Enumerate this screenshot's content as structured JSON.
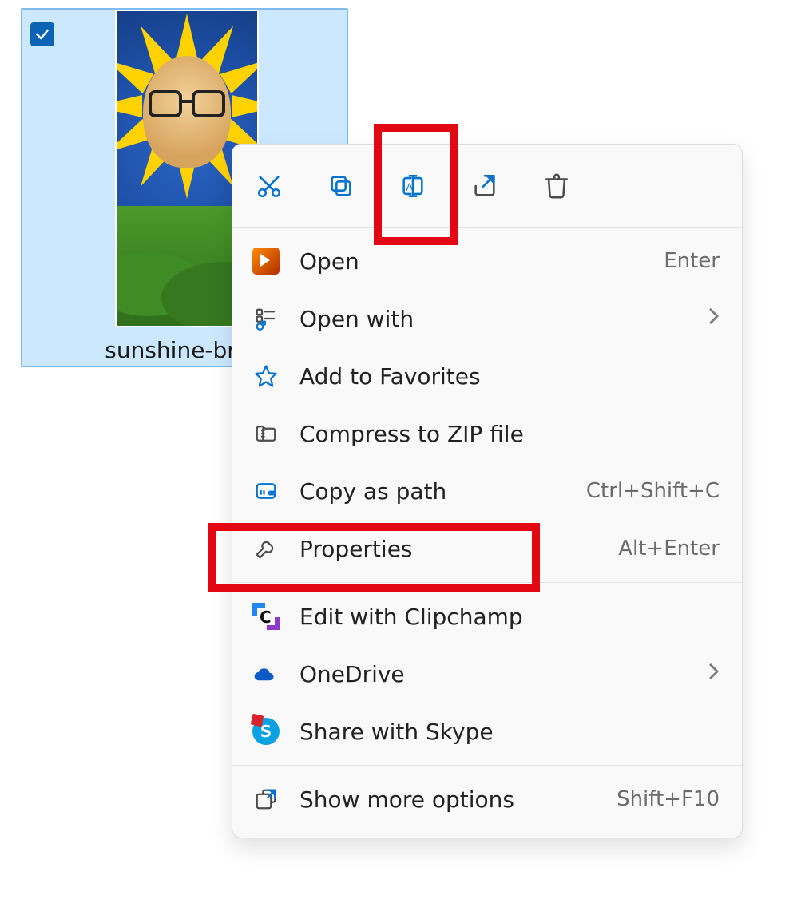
{
  "file": {
    "label": "sunshine-bran"
  },
  "toolbar": {
    "cut": "cut",
    "copy": "copy",
    "rename": "rename",
    "share": "share",
    "delete": "delete"
  },
  "menu": {
    "open": {
      "label": "Open",
      "accel": "Enter"
    },
    "open_with": {
      "label": "Open with",
      "submenu": true
    },
    "favorites": {
      "label": "Add to Favorites"
    },
    "compress": {
      "label": "Compress to ZIP file"
    },
    "copy_path": {
      "label": "Copy as path",
      "accel": "Ctrl+Shift+C"
    },
    "properties": {
      "label": "Properties",
      "accel": "Alt+Enter"
    },
    "clipchamp": {
      "label": "Edit with Clipchamp"
    },
    "onedrive": {
      "label": "OneDrive",
      "submenu": true
    },
    "skype": {
      "label": "Share with Skype"
    },
    "more": {
      "label": "Show more options",
      "accel": "Shift+F10"
    }
  },
  "annotations": {
    "rename_highlight": "highlighted",
    "properties_highlight": "highlighted"
  }
}
